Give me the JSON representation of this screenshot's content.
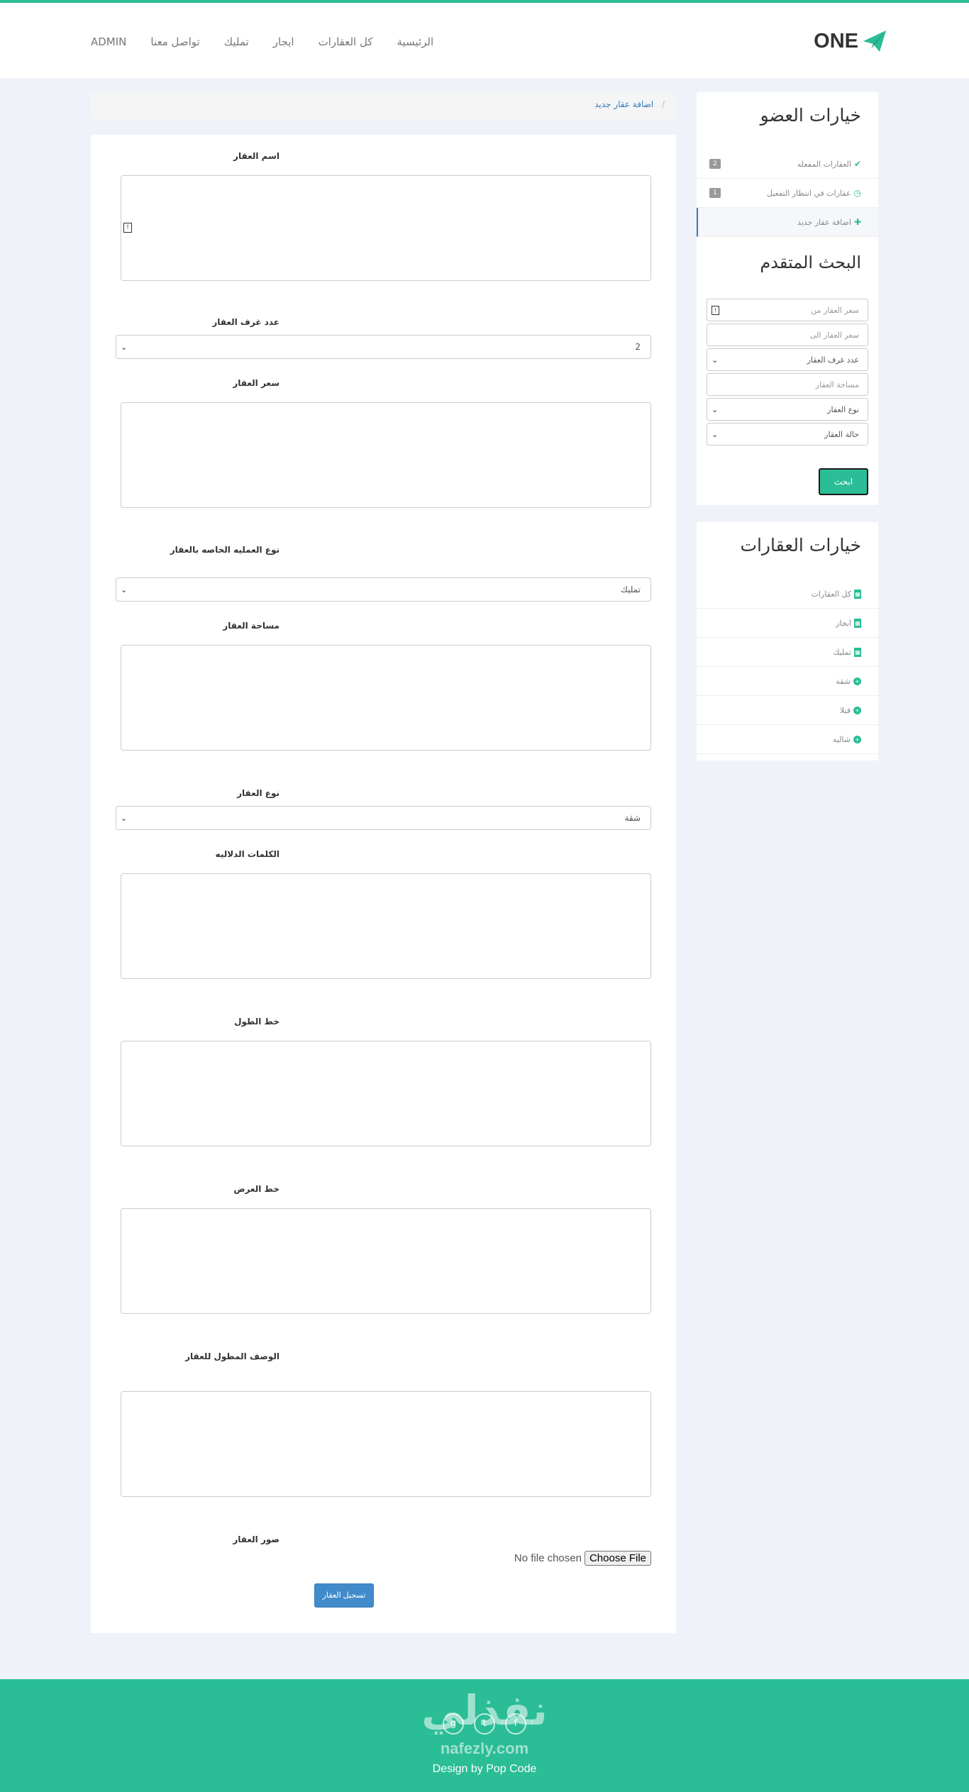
{
  "header": {
    "logo_text": "ONE",
    "nav": [
      "ADMIN",
      "تواصل معنا",
      "تمليك",
      "ايجار",
      "كل العقارات",
      "الرئيسية"
    ]
  },
  "breadcrumb": {
    "separator": "/",
    "current": "اضافة عقار جديد"
  },
  "form": {
    "name_label": "اسم العقار",
    "rooms_label": "عدد غرف العقار",
    "rooms_value": "2",
    "price_label": "سعر العقار",
    "operation_label": "نوع العمليه الخاصه بالعقار",
    "operation_value": "تمليك",
    "area_label": "مساحة العقار",
    "type_label": "نوع العقار",
    "type_value": "شقة",
    "keywords_label": "الكلمات الدلاليه",
    "longitude_label": "خط الطول",
    "latitude_label": "خط العرض",
    "description_label": "الوصف المطول للعقار",
    "images_label": "صور العقار",
    "no_file": "No file chosen",
    "choose_file": "Choose File",
    "submit": "تسجيل العقار"
  },
  "member": {
    "title": "خيارات العضو",
    "items": [
      {
        "label": "العقارات المفعله",
        "badge": "2"
      },
      {
        "label": "عقارات في انتظار التفعيل",
        "badge": "1"
      },
      {
        "label": "اضافة عقار جديد"
      }
    ]
  },
  "search": {
    "title": "البحث المتقدم",
    "price_from": "سعر العقار من",
    "price_to": "سعر العقار الى",
    "rooms": "عدد غرف العقار",
    "area": "مساحة العقار",
    "type": "نوع العقار",
    "status": "حالة العقار",
    "button": "ابحث"
  },
  "properties": {
    "title": "خيارات العقارات",
    "items": [
      "كل العقارات",
      "ايجار",
      "تمليك",
      "شقة",
      "فيلا",
      "شاليه"
    ]
  },
  "footer": {
    "watermark_ar": "نفذلي",
    "watermark_en": "nafezly.com",
    "credit": "Design by Pop Code"
  },
  "colors": {
    "accent": "#2abd96",
    "link": "#337ab7",
    "primary_button": "#428bca"
  }
}
